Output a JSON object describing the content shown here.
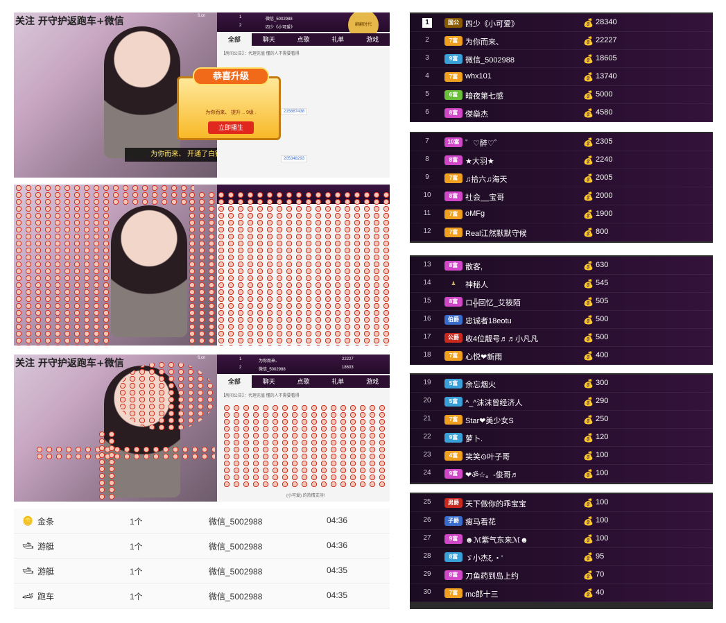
{
  "left_shots": {
    "shot1": {
      "overlay_text": "关注 开守护返跑车+微信",
      "site_badge": "6.cn",
      "mini_rank": [
        {
          "rank": "1",
          "name": "微信_5002988"
        },
        {
          "rank": "2",
          "name": "四少《小可爱》"
        }
      ],
      "tabs": [
        "全部",
        "聊天",
        "点歌",
        "礼单",
        "游戏"
      ],
      "notice": "【房间公告】：代理充值  懂的人不需要看得",
      "banner": "为你而来、 开通了白银守护!",
      "popup_title": "恭喜升级",
      "popup_line": "为你而来、 提升 .. 9级 .",
      "popup_button": "立即播生",
      "ticket1": "215887438",
      "ticket2": "205348293",
      "crown": "翻翻时代"
    },
    "shot3": {
      "overlay_text": "关注 开守护返跑车+微信",
      "site_badge": "6.cn",
      "mini_rank": [
        {
          "rank": "1",
          "name": "为你而来、",
          "score": "22227"
        },
        {
          "rank": "2",
          "name": "微信_5002988",
          "score": "18603"
        }
      ],
      "tabs": [
        "全部",
        "聊天",
        "点歌",
        "礼单",
        "游戏"
      ],
      "notice": "【房间公告】：代理充值  懂的人不需要看得",
      "footer": "(小可爱) 的热情支持!"
    }
  },
  "gift_list": [
    {
      "icon": "gold-bar-icon",
      "glyph": "🪙",
      "gift": "金条",
      "count": "1个",
      "user": "微信_5002988",
      "time": "04:36"
    },
    {
      "icon": "yacht-icon",
      "glyph": "🛥",
      "gift": "游艇",
      "count": "1个",
      "user": "微信_5002988",
      "time": "04:36"
    },
    {
      "icon": "yacht-icon",
      "glyph": "🛥",
      "gift": "游艇",
      "count": "1个",
      "user": "微信_5002988",
      "time": "04:35"
    },
    {
      "icon": "sports-car-icon",
      "glyph": "🏎",
      "gift": "跑车",
      "count": "1个",
      "user": "微信_5002988",
      "time": "04:35"
    }
  ],
  "ranks": [
    {
      "n": "1",
      "badge": "国公",
      "bc": "#8a5a00",
      "name": "四少《小可爱》",
      "score": "28340"
    },
    {
      "n": "2",
      "badge": "7富",
      "bc": "#f0a020",
      "name": "为你而来、",
      "score": "22227"
    },
    {
      "n": "3",
      "badge": "9富",
      "bc": "#3aa0d8",
      "name": "微信_5002988",
      "score": "18605"
    },
    {
      "n": "4",
      "badge": "7富",
      "bc": "#f0a020",
      "name": "whx101",
      "score": "13740"
    },
    {
      "n": "5",
      "badge": "6富",
      "bc": "#6abf3a",
      "name": "暗夜第七感",
      "score": "5000"
    },
    {
      "n": "6",
      "badge": "8富",
      "bc": "#d048c8",
      "name": "傑燊杰",
      "score": "4580"
    },
    {
      "n": "7",
      "badge": "10富",
      "bc": "#d048c8",
      "name": "゛♡醉♡゛",
      "score": "2305"
    },
    {
      "n": "8",
      "badge": "8富",
      "bc": "#d048c8",
      "name": "★大羽★",
      "score": "2240"
    },
    {
      "n": "9",
      "badge": "7富",
      "bc": "#f0a020",
      "name": "♫拾六♫海天",
      "score": "2005"
    },
    {
      "n": "10",
      "badge": "8富",
      "bc": "#d048c8",
      "name": "社会__宝哥",
      "score": "2000"
    },
    {
      "n": "11",
      "badge": "7富",
      "bc": "#f0a020",
      "name": "oMFg",
      "score": "1900"
    },
    {
      "n": "12",
      "badge": "7富",
      "bc": "#f0a020",
      "name": "Real江然默默守候",
      "score": "800"
    },
    {
      "n": "13",
      "badge": "8富",
      "bc": "#d048c8",
      "name": "散客,",
      "score": "630"
    },
    {
      "n": "14",
      "badge": "",
      "bc": "",
      "name": "神秘人",
      "score": "545"
    },
    {
      "n": "15",
      "badge": "8富",
      "bc": "#d048c8",
      "name": "ロ╬回忆_艾筱陌",
      "score": "505"
    },
    {
      "n": "16",
      "badge": "伯爵",
      "bc": "#3a6ccc",
      "name": "忠诚者18eotu",
      "score": "500"
    },
    {
      "n": "17",
      "badge": "公爵",
      "bc": "#c8281e",
      "name": "收4位靓号♬♬小凡凡",
      "score": "500"
    },
    {
      "n": "18",
      "badge": "7富",
      "bc": "#f0a020",
      "name": "心悦❤新雨",
      "score": "400"
    },
    {
      "n": "19",
      "badge": "5富",
      "bc": "#3aa0d8",
      "name": "余忘烟火",
      "score": "300"
    },
    {
      "n": "20",
      "badge": "5富",
      "bc": "#3aa0d8",
      "name": "^_^沫沫曾经济人",
      "score": "290"
    },
    {
      "n": "21",
      "badge": "7富",
      "bc": "#f0a020",
      "name": "Star❤美少女S",
      "score": "250"
    },
    {
      "n": "22",
      "badge": "9富",
      "bc": "#3aa0d8",
      "name": "萝卜.",
      "score": "120"
    },
    {
      "n": "23",
      "badge": "4富",
      "bc": "#f0a020",
      "name": "笑笑⊙叶子哥",
      "score": "100"
    },
    {
      "n": "24",
      "badge": "9富",
      "bc": "#d048c8",
      "name": "❤ॐ☆。-俊哥♬",
      "score": "100"
    },
    {
      "n": "25",
      "badge": "男爵",
      "bc": "#c8281e",
      "name": "天下做你的乖宝宝",
      "score": "100"
    },
    {
      "n": "26",
      "badge": "子爵",
      "bc": "#3a6ccc",
      "name": "瘦马看花",
      "score": "100"
    },
    {
      "n": "27",
      "badge": "9富",
      "bc": "#d048c8",
      "name": "☻ℳ紫气东来ℳ☻",
      "score": "100"
    },
    {
      "n": "28",
      "badge": "8富",
      "bc": "#3aa0d8",
      "name": "ゞ小杰ξ.・'",
      "score": "95"
    },
    {
      "n": "29",
      "badge": "8富",
      "bc": "#d048c8",
      "name": "刀鱼药到岛上约",
      "score": "70"
    },
    {
      "n": "30",
      "badge": "7富",
      "bc": "#f0a020",
      "name": "mc郎十三",
      "score": "40"
    }
  ],
  "faded": {
    "all": "全部",
    "song": "点歌",
    "gift": "礼单",
    "game": "游戏",
    "notice": "懂的人不需要看得",
    "id1": "214229300",
    "id2": "33324"
  },
  "colors": {
    "panel": "#2a0f31",
    "coin": "#f4c542"
  }
}
